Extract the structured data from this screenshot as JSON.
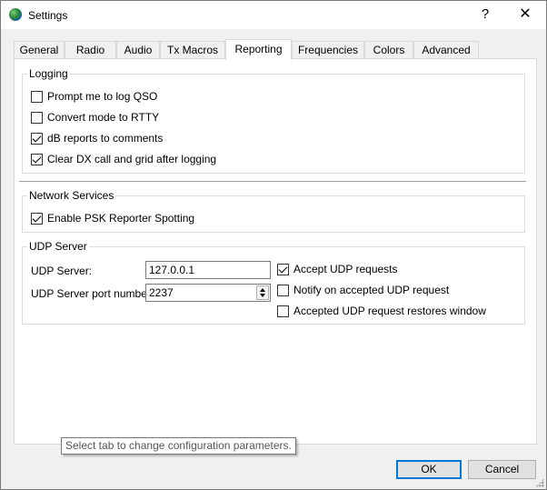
{
  "window": {
    "title": "Settings",
    "help_label": "?",
    "close_label": "✕"
  },
  "tabs": [
    {
      "label": "General"
    },
    {
      "label": "Radio"
    },
    {
      "label": "Audio"
    },
    {
      "label": "Tx Macros"
    },
    {
      "label": "Reporting"
    },
    {
      "label": "Frequencies"
    },
    {
      "label": "Colors"
    },
    {
      "label": "Advanced"
    }
  ],
  "active_tab": "Reporting",
  "logging": {
    "title": "Logging",
    "options": [
      {
        "label": "Prompt me to log QSO",
        "checked": false
      },
      {
        "label": "Convert mode to RTTY",
        "checked": false
      },
      {
        "label": "dB reports to comments",
        "checked": true
      },
      {
        "label": "Clear DX call and grid after logging",
        "checked": true
      }
    ]
  },
  "network": {
    "title": "Network Services",
    "options": [
      {
        "label": "Enable PSK Reporter Spotting",
        "checked": true
      }
    ]
  },
  "udp": {
    "title": "UDP Server",
    "server_label": "UDP Server:",
    "server_value": "127.0.0.1",
    "port_label": "UDP Server port number:",
    "port_value": "2237",
    "options": [
      {
        "label": "Accept UDP requests",
        "checked": true
      },
      {
        "label": "Notify on accepted UDP request",
        "checked": false
      },
      {
        "label": "Accepted UDP request restores window",
        "checked": false
      }
    ]
  },
  "tooltip": "Select tab to change configuration parameters.",
  "buttons": {
    "ok": "OK",
    "cancel": "Cancel"
  }
}
